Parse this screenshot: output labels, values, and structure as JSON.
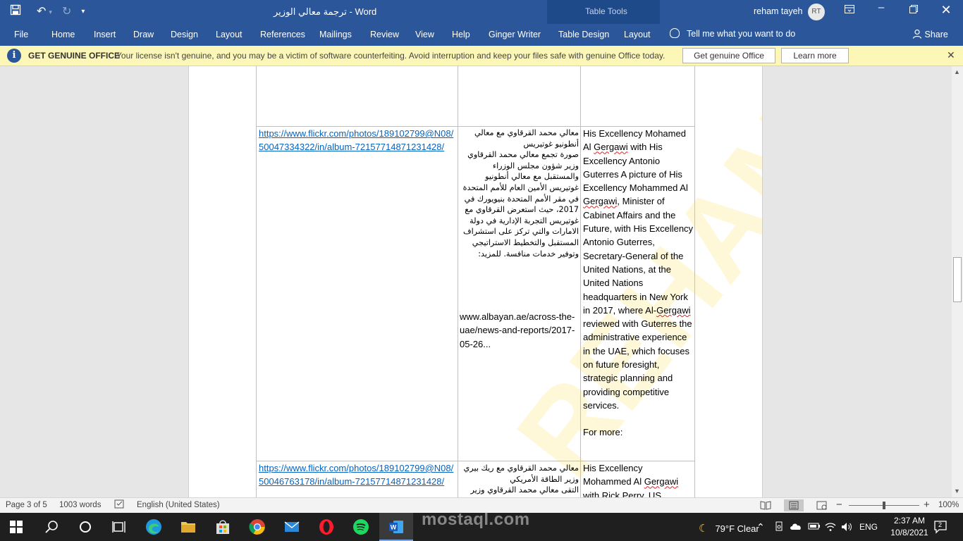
{
  "window": {
    "title": "ترجمة معالي الوزير  -  Word",
    "contextual_group": "Table Tools",
    "user_name": "reham tayeh",
    "user_initials": "RT"
  },
  "ribbon": {
    "tabs": [
      "File",
      "Home",
      "Insert",
      "Draw",
      "Design",
      "Layout",
      "References",
      "Mailings",
      "Review",
      "View",
      "Help",
      "Ginger Writer",
      "Table Design",
      "Layout"
    ],
    "tell_me": "Tell me what you want to do",
    "share": "Share"
  },
  "notice": {
    "heading": "GET GENUINE OFFICE",
    "message": "Your license isn't genuine, and you may be a victim of software counterfeiting. Avoid interruption and keep your files safe with genuine Office today.",
    "primary_button": "Get genuine Office",
    "secondary_button": "Learn more"
  },
  "document": {
    "watermark": "REHAM",
    "rows": [
      {
        "link": "https://www.flickr.com/photos/189102799@N08/50047334322/in/album-72157714871231428/",
        "arabic": "معالي محمد القرقاوي مع معالي أنطونيو غوتيريس\nصورة تجمع معالي محمد القرقاوي وزير شؤون مجلس الوزراء والمستقبل مع معالي أنطونيو غوتيريس الأمين العام للأمم المتحدة في مقر الأمم المتحدة بنيويورك في 2017، حيث استعرض القرقاوي مع غوتيريس التجربة الإدارية في دولة الامارات والتي تركز على استشراف المستقبل والتخطيط الاستراتيجي وتوفير خدمات منافسة. للمزيد:",
        "arabic_url": "www.albayan.ae/across-the-uae/news-and-reports/2017-05-26...",
        "english": "His Excellency Mohamed Al Gergawi with His Excellency Antonio Guterres A picture of His Excellency Mohammed Al Gergawi, Minister of Cabinet Affairs and the Future, with His Excellency Antonio Guterres, Secretary-General of the United Nations, at the United Nations headquarters in New York in 2017, where Al-Gergawi reviewed with Guterres the administrative experience in the UAE, which focuses on future foresight, strategic planning and providing competitive services.",
        "english_more": "For more:"
      },
      {
        "link": "https://www.flickr.com/photos/189102799@N08/50046763178/in/album-72157714871231428/",
        "arabic": "معالي محمد القرقاوي مع ريك بيري وزير الطاقة الأمريكي\nالتقى معالي محمد القرقاوي وزير",
        "english": "His Excellency Mohammed Al Gergawi with Rick Perry, US"
      }
    ]
  },
  "statusbar": {
    "page": "Page 3 of 5",
    "words": "1003 words",
    "language": "English (United States)",
    "zoom": "100%",
    "zoom_level": 1.0
  },
  "taskbar": {
    "weather": "79°F  Clear",
    "language": "ENG",
    "time": "2:37 AM",
    "date": "10/8/2021",
    "notification_count": "2"
  },
  "overlay_watermark": "mostaql.com",
  "colors": {
    "word_blue": "#2b579a",
    "notice_bg": "#fcf7b6",
    "link": "#0563c1",
    "taskbar": "#1f1f1f"
  }
}
